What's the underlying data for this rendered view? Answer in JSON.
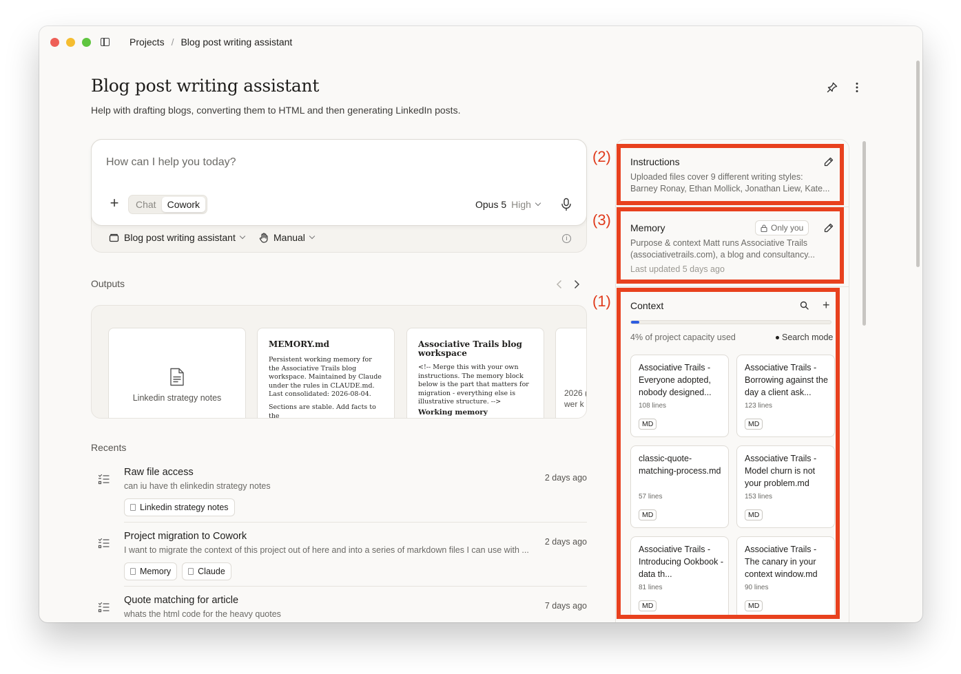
{
  "breadcrumb": {
    "root": "Projects",
    "separator": "/",
    "current": "Blog post writing assistant"
  },
  "header": {
    "title": "Blog post writing assistant",
    "description": "Help with drafting blogs, converting them to HTML and then generating LinkedIn posts."
  },
  "composer": {
    "placeholder": "How can I help you today?",
    "modes": [
      "Chat",
      "Cowork"
    ],
    "active_mode": "Cowork",
    "model": "Opus 5",
    "effort": "High",
    "project": "Blog post writing assistant",
    "permission": "Manual"
  },
  "outputs": {
    "label": "Outputs",
    "cards": [
      {
        "kind": "file",
        "label": "Linkedin strategy notes"
      },
      {
        "kind": "doc",
        "title": "MEMORY.md",
        "body": "Persistent working memory for the Associative Trails blog workspace. Maintained by Claude under the rules in CLAUDE.md. Last consolidated: 2026-08-04.",
        "body2": "Sections are stable. Add facts to the"
      },
      {
        "kind": "doc",
        "title": "Associative Trails blog workspace",
        "body": "<!-- Merge this with your own instructions. The memory block below is the part that matters for migration - everything else is illustrative structure. -->",
        "sub": "Working memory"
      },
      {
        "kind": "partial",
        "line1": "2026 (",
        "line2": "wer k"
      }
    ]
  },
  "recents": {
    "label": "Recents",
    "items": [
      {
        "title": "Raw file access",
        "subtitle": "can iu have th elinkedin strategy notes",
        "time": "2 days ago",
        "chips": [
          "Linkedin strategy notes"
        ]
      },
      {
        "title": "Project migration to Cowork",
        "subtitle": "I want to migrate the context of this project out of here and into a series of markdown files I can use with ...",
        "time": "2 days ago",
        "chips": [
          "Memory",
          "Claude"
        ]
      },
      {
        "title": "Quote matching for article",
        "subtitle": "whats the html code for the heavy quotes",
        "time": "7 days ago",
        "chips": []
      }
    ]
  },
  "instructions": {
    "title": "Instructions",
    "line1": "Uploaded files cover 9 different writing styles:",
    "line2": "Barney Ronay, Ethan Mollick, Jonathan Liew, Kate..."
  },
  "memory": {
    "title": "Memory",
    "visibility": "Only you",
    "line1": "Purpose & context Matt runs Associative Trails",
    "line2": "(associativetrails.com), a blog and consultancy...",
    "updated": "Last updated 5 days ago"
  },
  "context": {
    "title": "Context",
    "capacity_text": "4% of project capacity used",
    "capacity_fraction": 0.04,
    "search_mode": "Search mode",
    "files": [
      {
        "name": "Associative Trails - Everyone adopted, nobody designed...",
        "lines": "108 lines",
        "type": "MD"
      },
      {
        "name": "Associative Trails - Borrowing against the day a client ask...",
        "lines": "123 lines",
        "type": "MD"
      },
      {
        "name": "classic-quote-matching-process.md",
        "lines": "57 lines",
        "type": "MD"
      },
      {
        "name": "Associative Trails - Model churn is not your problem.md",
        "lines": "153 lines",
        "type": "MD"
      },
      {
        "name": "Associative Trails - Introducing Ookbook - data th...",
        "lines": "81 lines",
        "type": "MD"
      },
      {
        "name": "Associative Trails - The canary in your context window.md",
        "lines": "90 lines",
        "type": "MD"
      }
    ]
  },
  "annotations": {
    "label_1": "(1)",
    "label_2": "(2)",
    "label_3": "(3)",
    "color": "#e8411e"
  },
  "icons": [
    "sidebar-icon",
    "pin-icon",
    "more-icon",
    "plus-icon",
    "mic-icon",
    "project-icon",
    "hand-icon",
    "info-icon",
    "file-icon",
    "chat-list-icon",
    "edit-icon",
    "lock-icon",
    "search-icon"
  ]
}
